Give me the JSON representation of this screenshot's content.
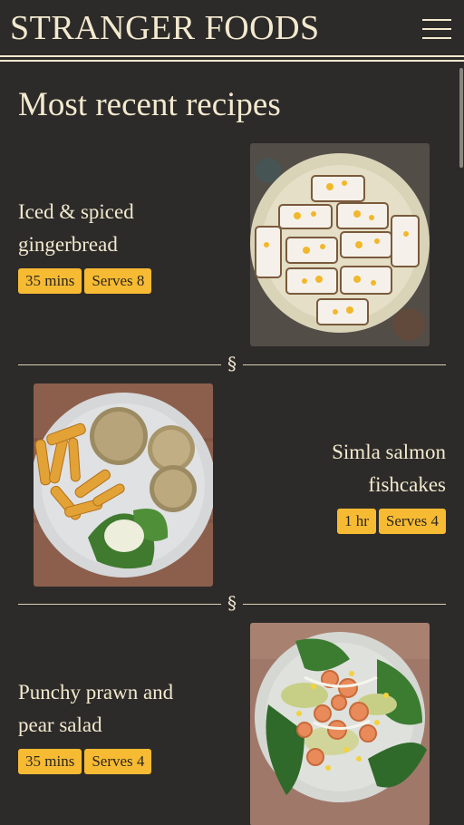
{
  "site": {
    "title": "STRANGER FOODS",
    "menu_icon": "hamburger-menu-icon"
  },
  "page": {
    "heading": "Most recent recipes"
  },
  "divider_symbol": "§",
  "recipes": [
    {
      "title_line1": "Iced & spiced",
      "title_line2": "gingerbread",
      "time": "35 mins",
      "serves": "Serves 8",
      "photo": "iced gingerbread slices on a plate"
    },
    {
      "title_line1": "Simla salmon",
      "title_line2": "fishcakes",
      "time": "1 hr",
      "serves": "Serves 4",
      "photo": "salmon fishcakes with potato wedges and salad"
    },
    {
      "title_line1": "Punchy prawn and",
      "title_line2": "pear salad",
      "time": "35 mins",
      "serves": "Serves 4",
      "photo": "prawn and pear salad on a plate"
    }
  ],
  "colors": {
    "background": "#2d2b29",
    "text": "#f3e9cf",
    "tag": "#f7bb33"
  }
}
